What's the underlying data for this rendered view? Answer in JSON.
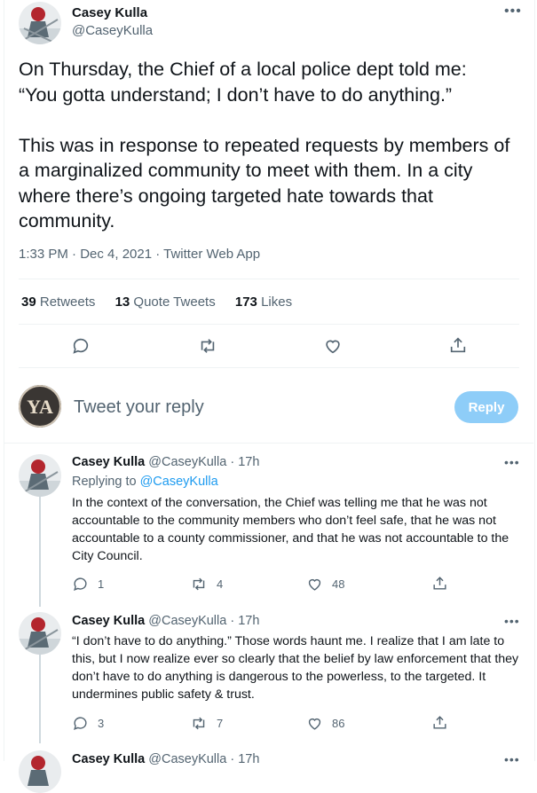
{
  "main_tweet": {
    "author_name": "Casey Kulla",
    "author_handle": "@CaseyKulla",
    "text": "On Thursday, the Chief of a local police dept told me:\n“You gotta understand; I don’t have to do anything.”\n\nThis was in response to repeated requests by members of a marginalized community to meet with them. In a city where there’s ongoing targeted hate towards that community.",
    "meta": "1:33 PM · Dec 4, 2021 · Twitter Web App",
    "retweets_count": "39",
    "retweets_label": "Retweets",
    "quotes_count": "13",
    "quotes_label": "Quote Tweets",
    "likes_count": "173",
    "likes_label": "Likes"
  },
  "compose": {
    "avatar_text": "YA",
    "placeholder": "Tweet your reply",
    "button_label": "Reply"
  },
  "replies": [
    {
      "author_name": "Casey Kulla",
      "author_handle": "@CaseyKulla · 17h",
      "replying_label": "Replying to",
      "replying_handle": "@CaseyKulla",
      "text": "In the context of the conversation, the Chief was telling me that he was not accountable to the community members who don’t feel safe, that he was not accountable to a county commissioner, and that he was not accountable to the City Council.",
      "reply_count": "1",
      "retweet_count": "4",
      "like_count": "48"
    },
    {
      "author_name": "Casey Kulla",
      "author_handle": "@CaseyKulla · 17h",
      "text": "“I don’t have to do anything.” Those words haunt me. I realize that I am late to this, but I now realize ever so clearly that the belief by law enforcement that they don’t have to do anything is dangerous to the powerless, to the targeted. It undermines public safety & trust.",
      "reply_count": "3",
      "retweet_count": "7",
      "like_count": "86"
    },
    {
      "author_name": "Casey Kulla",
      "author_handle": "@CaseyKulla · 17h"
    }
  ],
  "more_label": "•••",
  "colors": {
    "accent": "#1d9bf0",
    "reply_button": "#8ecdf8",
    "secondary_text": "#536471",
    "border": "#eff3f4"
  },
  "icons": [
    "reply-icon",
    "retweet-icon",
    "like-icon",
    "share-icon",
    "more-icon"
  ]
}
